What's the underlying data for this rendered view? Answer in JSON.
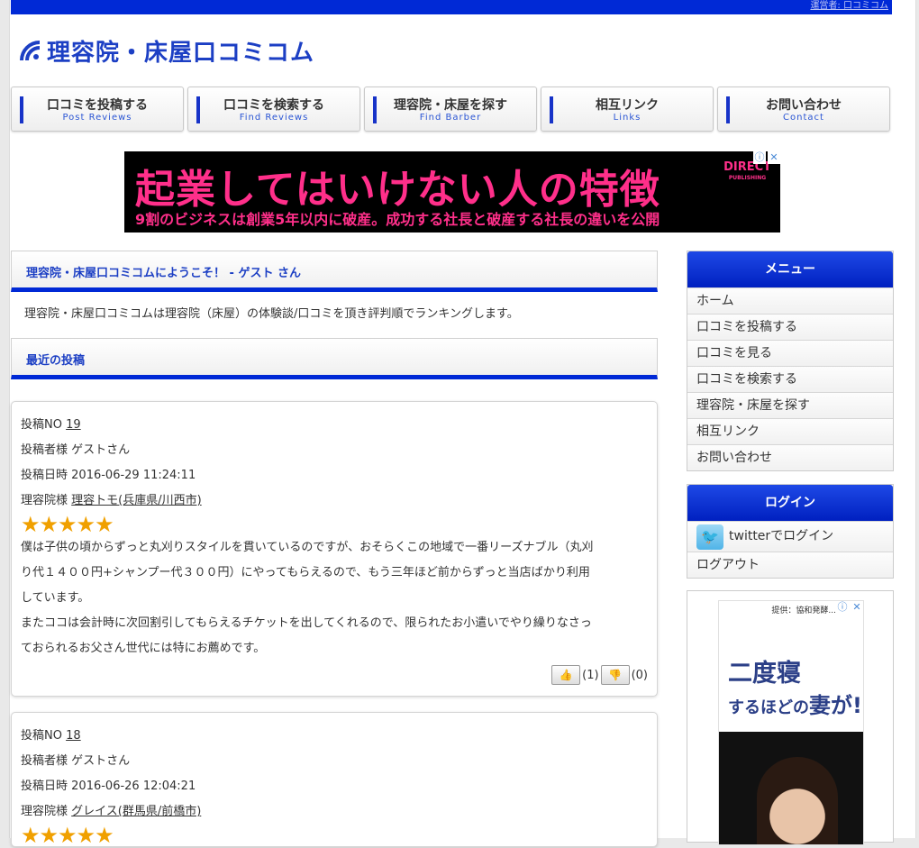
{
  "header": {
    "topbar_text": "運営者: 口コミコム",
    "site_title": "理容院・床屋口コミコム"
  },
  "nav": [
    {
      "jp": "口コミを投稿する",
      "en": "Post Reviews"
    },
    {
      "jp": "口コミを検索する",
      "en": "Find Reviews"
    },
    {
      "jp": "理容院・床屋を探す",
      "en": "Find Barber"
    },
    {
      "jp": "相互リンク",
      "en": "Links"
    },
    {
      "jp": "お問い合わせ",
      "en": "Contact"
    }
  ],
  "ad_banner": {
    "headline": "起業してはいけない人の特徴",
    "subline": "9割のビジネスは創業5年以内に破産。成功する社長と破産する社長の違いを公開",
    "brand": "DIRECT",
    "brand_sub": "PUBLISHING"
  },
  "main": {
    "welcome_heading": "理容院・床屋口コミコムにようこそ！ - ゲスト さん",
    "intro": "理容院・床屋口コミコムは理容院（床屋）の体験談/口コミを頂き評判順でランキングします。",
    "recent_heading": "最近の投稿",
    "posts": [
      {
        "no_label": "投稿NO",
        "no": "19",
        "author_label": "投稿者様",
        "author": "ゲストさん",
        "date_label": "投稿日時",
        "date": "2016-06-29 11:24:11",
        "shop_label": "理容院様",
        "shop": "理容トモ(兵庫県/川西市)",
        "stars": "★★★★★",
        "review_lines": [
          "僕は子供の頃からずっと丸刈りスタイルを貫いているのですが、おそらくこの地域で一番リーズナブル（丸刈",
          "り代１４００円+シャンプー代３００円）にやってもらえるので、もう三年ほど前からずっと当店ばかり利用",
          "しています。",
          "またココは会計時に次回割引してもらえるチケットを出してくれるので、限られたお小遣いでやり繰りなさっ",
          "ておられるお父さん世代には特にお薦めです。"
        ],
        "up_count": "(1)",
        "down_count": "(0)"
      },
      {
        "no_label": "投稿NO",
        "no": "18",
        "author_label": "投稿者様",
        "author": "ゲストさん",
        "date_label": "投稿日時",
        "date": "2016-06-26 12:04:21",
        "shop_label": "理容院様",
        "shop": "グレイス(群馬県/前橋市)",
        "stars": "★★★★★"
      }
    ]
  },
  "sidebar": {
    "menu_title": "メニュー",
    "menu_items": [
      "ホーム",
      "口コミを投稿する",
      "口コミを見る",
      "口コミを検索する",
      "理容院・床屋を探す",
      "相互リンク",
      "お問い合わせ"
    ],
    "login_title": "ログイン",
    "twitter_login": "twitterでログイン",
    "logout": "ログアウト",
    "ad": {
      "credit": "提供：協和発酵...",
      "text1": "二度寝",
      "text2a": "するほどの",
      "text2b": "妻が!"
    }
  },
  "colors": {
    "accent": "#0029d6",
    "title_blue": "#1c3fc4",
    "star": "#f0a000",
    "ad_pink": "#ff2f8a"
  }
}
